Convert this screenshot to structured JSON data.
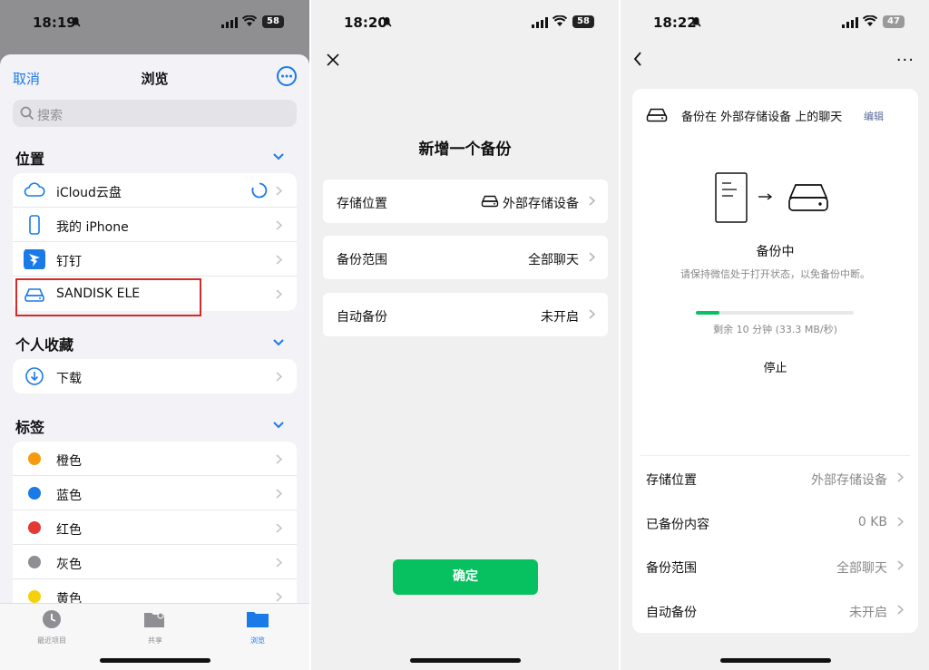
{
  "panel1": {
    "status": {
      "time": "18:19",
      "battery": "58"
    },
    "nav": {
      "cancel": "取消",
      "title": "浏览"
    },
    "search": {
      "placeholder": "搜索"
    },
    "locations": {
      "header": "位置",
      "items": [
        {
          "label": "iCloud云盘",
          "icon": "cloud-icon"
        },
        {
          "label": "我的 iPhone",
          "icon": "iphone-icon"
        },
        {
          "label": "钉钉",
          "icon": "dingtalk-icon"
        },
        {
          "label": "SANDISK ELE",
          "icon": "external-drive-icon"
        }
      ]
    },
    "favorites": {
      "header": "个人收藏",
      "items": [
        {
          "label": "下载",
          "icon": "download-icon"
        }
      ]
    },
    "tags": {
      "header": "标签",
      "items": [
        {
          "label": "橙色",
          "color": "#f39c12"
        },
        {
          "label": "蓝色",
          "color": "#1a7ae8"
        },
        {
          "label": "红色",
          "color": "#e53935"
        },
        {
          "label": "灰色",
          "color": "#8e8e93"
        },
        {
          "label": "黄色",
          "color": "#f5d00f"
        }
      ]
    },
    "tabbar": [
      {
        "label": "最近项目",
        "active": false
      },
      {
        "label": "共享",
        "active": false
      },
      {
        "label": "浏览",
        "active": true
      }
    ]
  },
  "panel2": {
    "status": {
      "time": "18:20",
      "battery": "58"
    },
    "title": "新增一个备份",
    "rows": [
      {
        "key": "存储位置",
        "value": "外部存储设备"
      },
      {
        "key": "备份范围",
        "value": "全部聊天"
      },
      {
        "key": "自动备份",
        "value": "未开启"
      }
    ],
    "confirm": "确定"
  },
  "panel3": {
    "status": {
      "time": "18:22",
      "battery": "47"
    },
    "more": "···",
    "header": {
      "text": "备份在 外部存储设备 上的聊天",
      "edit": "编辑"
    },
    "progress": {
      "title": "备份中",
      "hint": "请保持微信处于打开状态，以免备份中断。",
      "fraction": 0.15,
      "remaining": "剩余 10 分钟 (33.3 MB/秒)",
      "stop": "停止"
    },
    "rows": [
      {
        "key": "存储位置",
        "value": "外部存储设备"
      },
      {
        "key": "已备份内容",
        "value": "0 KB"
      },
      {
        "key": "备份范围",
        "value": "全部聊天"
      },
      {
        "key": "自动备份",
        "value": "未开启"
      }
    ]
  },
  "colors": {
    "ios_blue": "#1a7ae8",
    "wechat_green": "#07c160",
    "highlight_red": "#d42a2a"
  }
}
